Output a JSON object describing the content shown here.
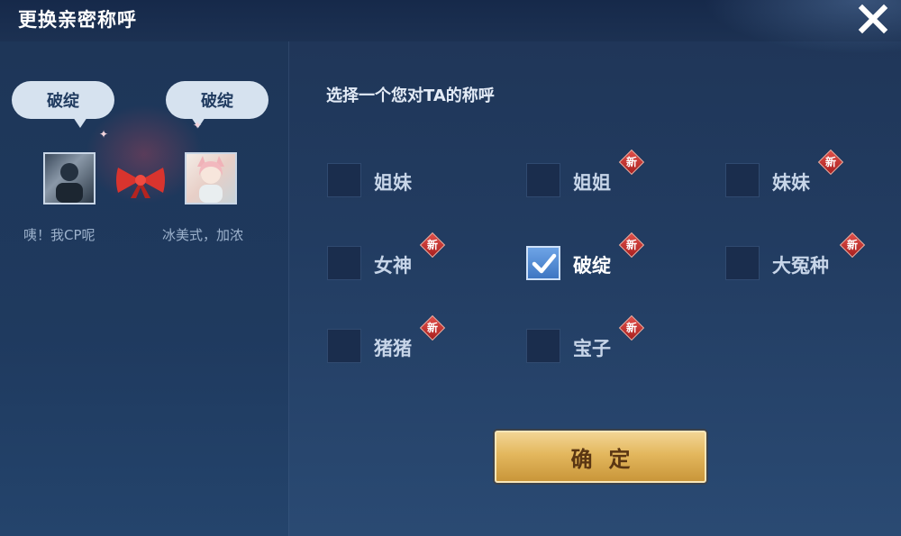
{
  "header": {
    "title": "更换亲密称呼"
  },
  "preview": {
    "left_bubble": "破绽",
    "right_bubble": "破绽",
    "left_status": "咦！我CP呢",
    "right_status": "冰美式，加浓"
  },
  "prompt": "选择一个您对TA的称呼",
  "new_badge_text": "新",
  "options": [
    {
      "label": "姐妹",
      "is_new": false,
      "checked": false
    },
    {
      "label": "姐姐",
      "is_new": true,
      "checked": false
    },
    {
      "label": "妹妹",
      "is_new": true,
      "checked": false
    },
    {
      "label": "女神",
      "is_new": true,
      "checked": false
    },
    {
      "label": "破绽",
      "is_new": true,
      "checked": true
    },
    {
      "label": "大冤种",
      "is_new": true,
      "checked": false
    },
    {
      "label": "猪猪",
      "is_new": true,
      "checked": false
    },
    {
      "label": "宝子",
      "is_new": true,
      "checked": false
    }
  ],
  "confirm_label": "确定",
  "colors": {
    "accent_gold": "#e3b75d",
    "badge_red": "#c8322f",
    "check_blue": "#4a86d4"
  }
}
